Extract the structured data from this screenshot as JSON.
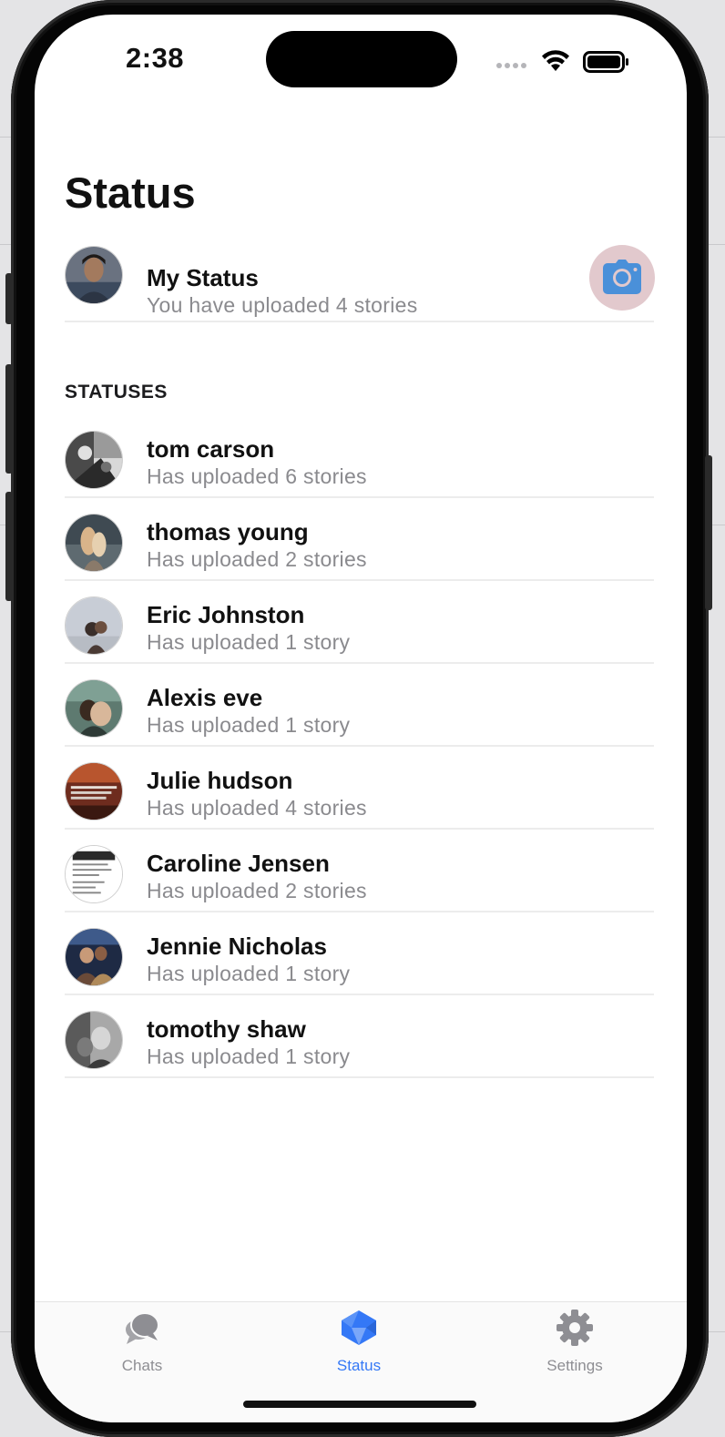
{
  "statusbar": {
    "time": "2:38"
  },
  "header": {
    "title": "Status"
  },
  "my_status": {
    "title": "My Status",
    "subtitle": "You have uploaded 4 stories",
    "camera_icon": "camera-icon"
  },
  "section": {
    "label": "STATUSES"
  },
  "statuses": [
    {
      "name": "tom carson",
      "subtitle": "Has uploaded 6 stories"
    },
    {
      "name": "thomas young",
      "subtitle": "Has uploaded 2 stories"
    },
    {
      "name": "Eric Johnston",
      "subtitle": "Has uploaded 1 story"
    },
    {
      "name": "Alexis eve",
      "subtitle": "Has uploaded 1 story"
    },
    {
      "name": "Julie hudson",
      "subtitle": "Has uploaded 4 stories"
    },
    {
      "name": "Caroline Jensen",
      "subtitle": "Has uploaded 2 stories"
    },
    {
      "name": "Jennie Nicholas",
      "subtitle": "Has uploaded 1 story"
    },
    {
      "name": "tomothy shaw",
      "subtitle": "Has uploaded 1 story"
    }
  ],
  "tabs": [
    {
      "label": "Chats",
      "icon": "chat-bubbles-icon",
      "active": false
    },
    {
      "label": "Status",
      "icon": "status-icon",
      "active": true
    },
    {
      "label": "Settings",
      "icon": "gear-icon",
      "active": false
    }
  ],
  "colors": {
    "accent": "#3478f6",
    "inactive_tab": "#8e8e93",
    "subtitle": "#8a8a8e",
    "camera_bg": "#e2c9cd",
    "camera_icon": "#4a90d9"
  }
}
